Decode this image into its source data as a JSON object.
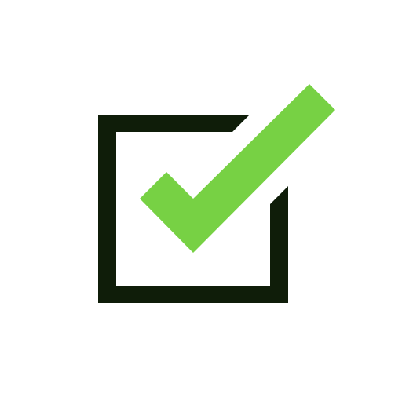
{
  "icon": {
    "name": "checkbox-checked-icon",
    "colors": {
      "background": "#ffffff",
      "box": "#0f1d09",
      "checkmark": "#77d144"
    }
  }
}
